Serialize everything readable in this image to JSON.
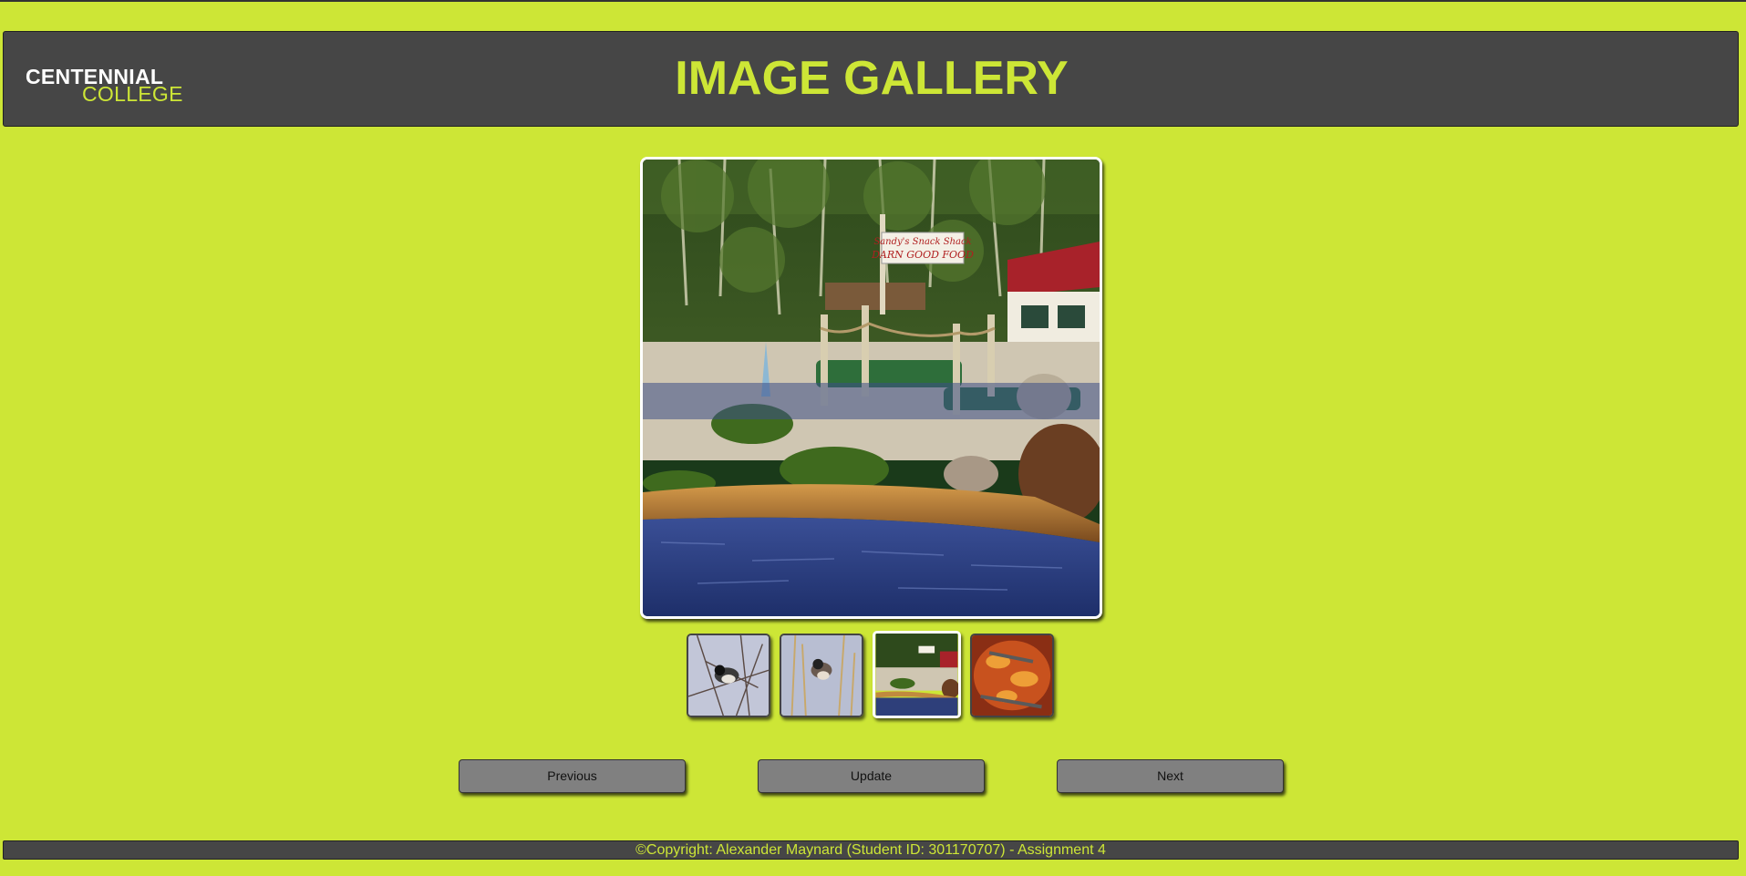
{
  "header": {
    "logo_line1": "CENTENNIAL",
    "logo_line2": "COLLEGE",
    "title": "IMAGE GALLERY"
  },
  "gallery": {
    "main_image_icon": "image-icon",
    "main_sign_line1": "Sandy's Snack Shack",
    "main_sign_line2": "DARN GOOD FOOD",
    "thumbnails": [
      {
        "name": "bird-on-branch",
        "selected": false
      },
      {
        "name": "bird-in-reeds",
        "selected": false
      },
      {
        "name": "mini-golf-pond",
        "selected": true
      },
      {
        "name": "campfire-embers",
        "selected": false
      }
    ]
  },
  "controls": {
    "previous_label": "Previous",
    "update_label": "Update",
    "next_label": "Next"
  },
  "footer": {
    "copyright": "©Copyright: Alexander Maynard (Student ID: 301170707) - Assignment 4"
  },
  "colors": {
    "background": "#cde636",
    "header_bg": "#464646",
    "accent": "#cde636",
    "button_bg": "#808080"
  }
}
